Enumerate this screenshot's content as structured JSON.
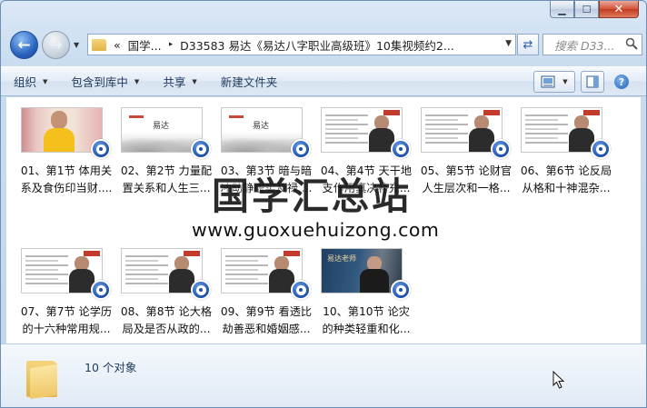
{
  "window": {
    "minimize_glyph": "▁",
    "maximize_glyph": "☐",
    "close_glyph": "✕"
  },
  "address_bar": {
    "overflow_glyph": "«",
    "crumbs": [
      "国学...",
      "D33583 易达《易达八字职业高级班》10集视频约2..."
    ],
    "separator": "▸"
  },
  "search": {
    "placeholder": "搜索 D33..."
  },
  "toolbar": {
    "organize": "组织",
    "include_in_library": "包含到库中",
    "share": "共享",
    "new_folder": "新建文件夹"
  },
  "files": [
    {
      "line1": "01、第1节 体用关",
      "line2": "系及食伤印当财....",
      "thumb": "photo"
    },
    {
      "line1": "02、第2节 力量配",
      "line2": "置关系和人生三...",
      "thumb": "ink"
    },
    {
      "line1": "03、第3节 暗与暗",
      "line2": "冲动静虚实及禄....",
      "thumb": "ink"
    },
    {
      "line1": "04、第4节 天干地",
      "line2": "支作用真决补充...",
      "thumb": "slide"
    },
    {
      "line1": "05、第5节 论财官",
      "line2": "人生层次和一格...",
      "thumb": "slide"
    },
    {
      "line1": "06、第6节 论反局",
      "line2": "从格和十神混杂...",
      "thumb": "slide"
    },
    {
      "line1": "07、第7节 论学历",
      "line2": "的十六种常用规...",
      "thumb": "slide"
    },
    {
      "line1": "08、第8节 论大格",
      "line2": "局及是否从政的...",
      "thumb": "slide"
    },
    {
      "line1": "09、第9节 看透比",
      "line2": "劫善恶和婚姻感...",
      "thumb": "slide"
    },
    {
      "line1": "10、第10节 论灾",
      "line2": "的种类轻重和化...",
      "thumb": "dark"
    }
  ],
  "thumb_texts": {
    "ink_calligraphy": "易达",
    "dark_title": "易达老师"
  },
  "watermark": {
    "cn": "国学汇总站",
    "url": "www.guoxuehuizong.com"
  },
  "status": {
    "count_text": "10 个对象"
  },
  "colors": {
    "accent": "#1d4fa8",
    "close_red": "#c23a1f",
    "folder_yellow": "#efc766"
  }
}
